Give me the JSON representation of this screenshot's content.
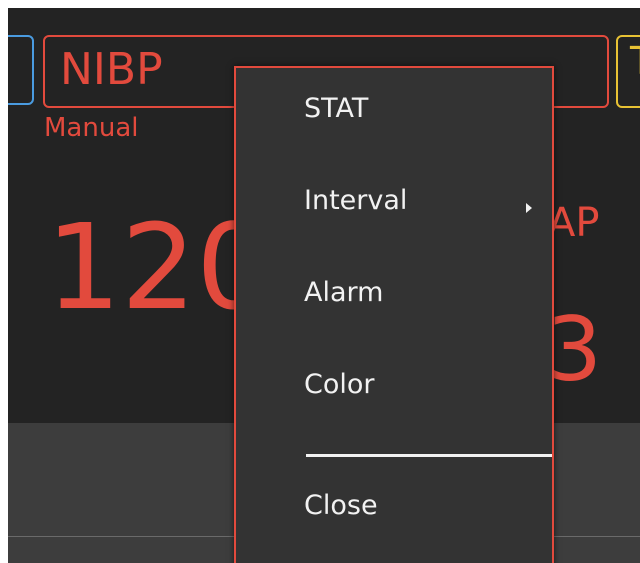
{
  "monitor": {
    "right_tile_letter": "T",
    "nibp": {
      "title": "NIBP",
      "mode": "Manual",
      "systolic_value": "120",
      "map_label": "AP",
      "map_value": "3"
    }
  },
  "context_menu": {
    "items": [
      {
        "label": "STAT"
      },
      {
        "label": "Interval",
        "has_submenu": true
      },
      {
        "label": "Alarm"
      },
      {
        "label": "Color"
      }
    ],
    "close_label": "Close"
  },
  "colors": {
    "nibp": "#e24a3d",
    "left_tile": "#4a9be0",
    "right_tile": "#e8c234",
    "background": "#232323",
    "menu_background": "#333333",
    "menu_text": "#f2f2f2"
  }
}
